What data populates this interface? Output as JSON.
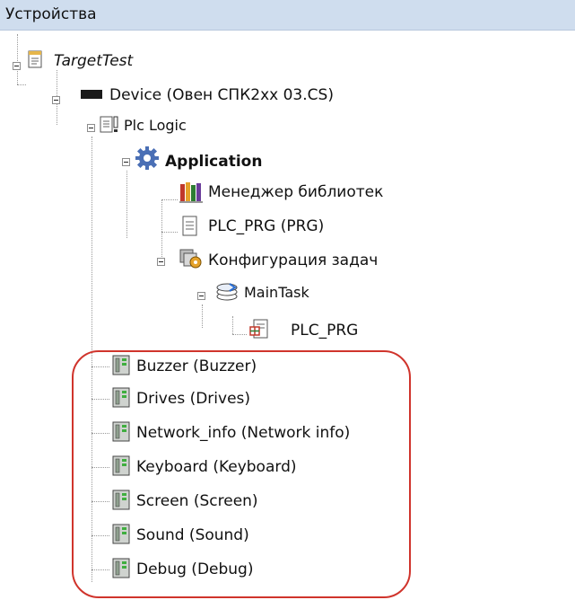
{
  "panel": {
    "title": "Устройства"
  },
  "tree": {
    "root": {
      "label": "TargetTest",
      "icon": "project-icon"
    },
    "device": {
      "label": "Device (Овен СПК2xx 03.CS)",
      "icon": "device-icon"
    },
    "plc_logic": {
      "label": "Plc Logic",
      "icon": "plc-logic-icon"
    },
    "application": {
      "label": "Application",
      "icon": "application-gear-icon"
    },
    "library_manager": {
      "label": "Менеджер библиотек",
      "icon": "library-icon"
    },
    "plc_prg": {
      "label": "PLC_PRG (PRG)",
      "icon": "document-icon"
    },
    "task_config": {
      "label": "Конфигурация задач",
      "icon": "task-config-icon"
    },
    "main_task": {
      "label": "MainTask",
      "icon": "task-stack-icon"
    },
    "task_plc_prg": {
      "label": "PLC_PRG",
      "icon": "program-call-icon"
    },
    "modules": [
      {
        "label": "Buzzer (Buzzer)",
        "icon": "module-icon"
      },
      {
        "label": "Drives (Drives)",
        "icon": "module-icon"
      },
      {
        "label": "Network_info (Network info)",
        "icon": "module-icon"
      },
      {
        "label": "Keyboard (Keyboard)",
        "icon": "module-icon"
      },
      {
        "label": "Screen (Screen)",
        "icon": "module-icon"
      },
      {
        "label": "Sound (Sound)",
        "icon": "module-icon"
      },
      {
        "label": "Debug (Debug)",
        "icon": "module-icon"
      }
    ]
  },
  "colors": {
    "header_bg": "#cfddee",
    "highlight": "#d0342c",
    "gear": "#4a6fb5",
    "device": "#1a1a1a"
  }
}
